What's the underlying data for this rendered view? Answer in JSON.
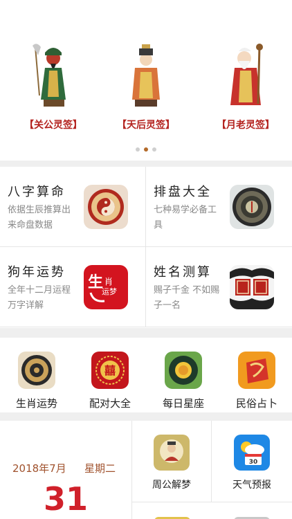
{
  "banner": {
    "slides": [
      {
        "label": "【关公灵签】",
        "icon": "guan-gong-figure"
      },
      {
        "label": "【天后灵签】",
        "icon": "tian-hou-figure"
      },
      {
        "label": "【月老灵签】",
        "icon": "yue-lao-figure"
      }
    ],
    "page_count": 3,
    "active_page": 2
  },
  "features": [
    {
      "title": "八字算命",
      "desc": "依据生辰推算出来命盘数据",
      "icon": "yin-yang-icon"
    },
    {
      "title": "排盘大全",
      "desc": "七种易学必备工具",
      "icon": "compass-icon"
    },
    {
      "title": "狗年运势",
      "desc": "全年十二月运程万字详解",
      "icon": "zodiac-2018-icon"
    },
    {
      "title": "姓名测算",
      "desc": "赐子千金 不如赐子一名",
      "icon": "name-seal-icon"
    }
  ],
  "quick": [
    {
      "label": "生肖运势",
      "icon": "zodiac-wheel-icon"
    },
    {
      "label": "配对大全",
      "icon": "double-happiness-icon"
    },
    {
      "label": "每日星座",
      "icon": "sun-constellation-icon"
    },
    {
      "label": "民俗占卜",
      "icon": "fortune-paper-icon"
    }
  ],
  "calendar": {
    "year_month": "2018年7月",
    "weekday": "星期二",
    "day": "31"
  },
  "tools": [
    {
      "label": "周公解梦",
      "icon": "zhou-gong-icon"
    },
    {
      "label": "天气预报",
      "icon": "weather-icon",
      "icon_text": "30"
    }
  ],
  "colors": {
    "accent_red": "#b4231f",
    "date_red": "#d0202a",
    "brown": "#a0522d",
    "dot_active": "#b36a2a"
  }
}
